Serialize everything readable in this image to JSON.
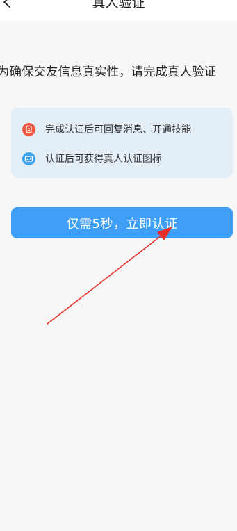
{
  "header": {
    "title": "真人验证",
    "back_icon": "chevron-left-icon"
  },
  "notice": {
    "text": "为确保交友信息真实性，请完成真人验证"
  },
  "benefits": [
    {
      "icon": "badge-certificate-icon",
      "icon_color": "#f0573f",
      "label": "完成认证后可回复消息、开通技能"
    },
    {
      "icon": "id-card-icon",
      "icon_color": "#3fa4f0",
      "label": "认证后可获得真人认证图标"
    }
  ],
  "cta": {
    "label": "仅需5秒，立即认证",
    "color": "#3f9ff6"
  },
  "annotation": {
    "arrow_color": "#e8302a"
  }
}
